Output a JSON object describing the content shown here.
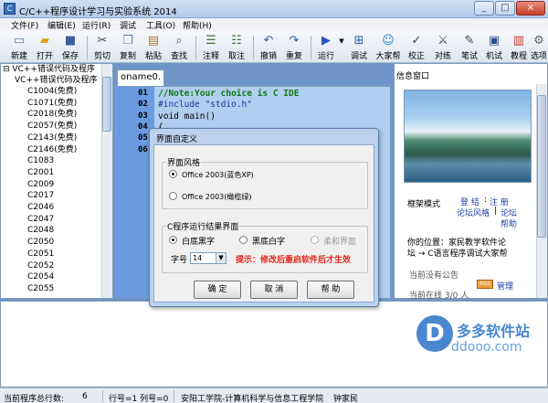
{
  "window": {
    "title": "C/C++程序设计学习与实验系统 2014",
    "controls": [
      "_",
      "□",
      "×"
    ]
  },
  "menu": [
    "文件(F)",
    "编辑(E)",
    "运行(R)",
    "调试",
    "工具(O)",
    "帮助(H)"
  ],
  "toolbar": [
    {
      "label": "新建",
      "icon": "new-file-icon"
    },
    {
      "label": "打开",
      "icon": "folder-open-icon"
    },
    {
      "label": "保存",
      "icon": "save-icon"
    },
    {
      "label": "剪切",
      "icon": "scissors-icon"
    },
    {
      "label": "复制",
      "icon": "copy-icon"
    },
    {
      "label": "粘贴",
      "icon": "paste-icon"
    },
    {
      "label": "查找",
      "icon": "magnifier-icon"
    },
    {
      "label": "注释",
      "icon": "comment-icon"
    },
    {
      "label": "取注",
      "icon": "uncomment-icon"
    },
    {
      "label": "撤销",
      "icon": "undo-icon"
    },
    {
      "label": "重复",
      "icon": "redo-icon"
    },
    {
      "label": "运行",
      "icon": "play-icon"
    },
    {
      "label": "调试",
      "icon": "debug-icon"
    },
    {
      "label": "大家帮",
      "icon": "help-crowd-icon"
    },
    {
      "label": "校正",
      "icon": "correct-icon"
    },
    {
      "label": "对练",
      "icon": "practice-icon"
    },
    {
      "label": "笔试",
      "icon": "pen-icon"
    },
    {
      "label": "机试",
      "icon": "computer-icon"
    },
    {
      "label": "教程",
      "icon": "book-icon"
    },
    {
      "label": "选项",
      "icon": "options-icon"
    }
  ],
  "tree": {
    "root": "VC++错误代码及程序",
    "child": "VC++错误代码及程序",
    "items": [
      "C1004(免费)",
      "C1071(免费)",
      "C2018(免费)",
      "C2057(免费)",
      "C2143(免费)",
      "C2146(免费)",
      "C1083",
      "C2001",
      "C2009",
      "C2017",
      "C2046",
      "C2047",
      "C2048",
      "C2050",
      "C2051",
      "C2052",
      "C2054",
      "C2055"
    ]
  },
  "editor": {
    "tab": "oname0.",
    "lines": [
      {
        "no": "01",
        "text": "//Note:Your choice is C IDE"
      },
      {
        "no": "02",
        "text": "#include \"stdio.h\""
      },
      {
        "no": "03",
        "text": "void main()"
      },
      {
        "no": "04",
        "text": "{"
      },
      {
        "no": "05",
        "text": ""
      },
      {
        "no": "06",
        "text": ""
      }
    ]
  },
  "info": {
    "title": "信息窗口",
    "mode_label": "框架模式",
    "login": "登 结",
    "register": "注 册",
    "forum": "论坛风格",
    "forum2": "论坛",
    "help": "帮助",
    "location_line1": "你的位置：家民教学软件论",
    "location_line2": "坛 → C语言程序调试大家帮",
    "online": "当前没有公告",
    "manage": "管理",
    "footer": "当前在线 3/0 人"
  },
  "dialog": {
    "title": "界面自定义",
    "style_group": "界面风格",
    "style_options": [
      "Office 2003(蓝色XP)",
      "Office 2003(橄榄绿)"
    ],
    "style_selected": 0,
    "result_group": "C程序运行结果界面",
    "result_options": [
      "白底黑字",
      "黑底白字",
      "柔和界面"
    ],
    "result_selected": 0,
    "font_label": "字号",
    "font_value": "14",
    "tip": "提示：修改后重启软件后才生效",
    "buttons": [
      "确 定",
      "取 消",
      "帮 助"
    ]
  },
  "status": {
    "total_lines": "当前程序总行数:",
    "total_lines_value": "6",
    "position": "行号=1 列号=0",
    "school": "安阳工学院-计算机科学与信息工程学院",
    "author": "钟家民"
  },
  "watermark": {
    "logo": "D",
    "name": "多多软件站",
    "url": "ddooo.com"
  }
}
